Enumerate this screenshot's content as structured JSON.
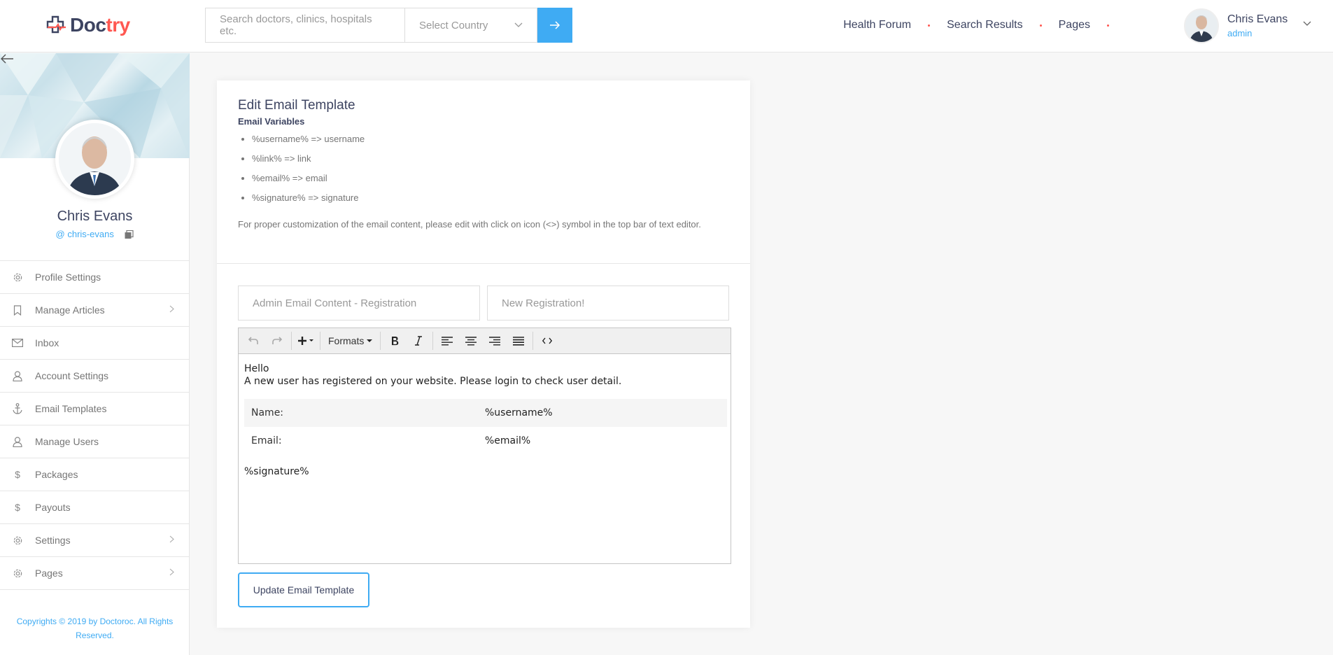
{
  "header": {
    "logo_prefix": "Doc",
    "logo_accent": "try",
    "search_placeholder": "Search doctors, clinics, hospitals etc.",
    "country_select": "Select Country",
    "nav": [
      "Health Forum",
      "Search Results",
      "Pages"
    ],
    "user_name": "Chris Evans",
    "user_role": "admin"
  },
  "sidebar": {
    "name": "Chris Evans",
    "handle": "@ chris-evans",
    "items": [
      {
        "label": "Profile Settings",
        "icon": "gear-icon",
        "chevron": false
      },
      {
        "label": "Manage Articles",
        "icon": "bookmark-icon",
        "chevron": true
      },
      {
        "label": "Inbox",
        "icon": "envelope-icon",
        "chevron": false
      },
      {
        "label": "Account Settings",
        "icon": "user-icon",
        "chevron": false
      },
      {
        "label": "Email Templates",
        "icon": "anchor-icon",
        "chevron": false
      },
      {
        "label": "Manage Users",
        "icon": "user-icon",
        "chevron": false
      },
      {
        "label": "Packages",
        "icon": "dollar-icon",
        "chevron": false
      },
      {
        "label": "Payouts",
        "icon": "dollar-icon",
        "chevron": false
      },
      {
        "label": "Settings",
        "icon": "gear-icon",
        "chevron": true
      },
      {
        "label": "Pages",
        "icon": "gear-icon",
        "chevron": true
      }
    ],
    "copyright": "Copyrights © 2019 by Doctoroc. All Rights Reserved."
  },
  "card": {
    "title": "Edit Email Template",
    "vars_title": "Email Variables",
    "variables": [
      "%username% => username",
      "%link% => link",
      "%email% => email",
      "%signature% => signature"
    ],
    "help": "For proper customization of the email content, please edit with click on icon (<>) symbol in the top bar of text editor.",
    "field_title": "Admin Email Content - Registration",
    "field_subject": "New Registration!",
    "toolbar_formats": "Formats",
    "editor": {
      "greeting": "Hello",
      "line": "A new user has registered on your website. Please login to check user detail.",
      "rows": [
        {
          "label": "Name:",
          "value": "%username%"
        },
        {
          "label": "Email:",
          "value": "%email%"
        }
      ],
      "signature": "%signature%"
    },
    "submit": "Update Email Template"
  },
  "colors": {
    "accent": "#3fabf3",
    "brand_red": "#ff5851",
    "heading": "#3d4461"
  }
}
